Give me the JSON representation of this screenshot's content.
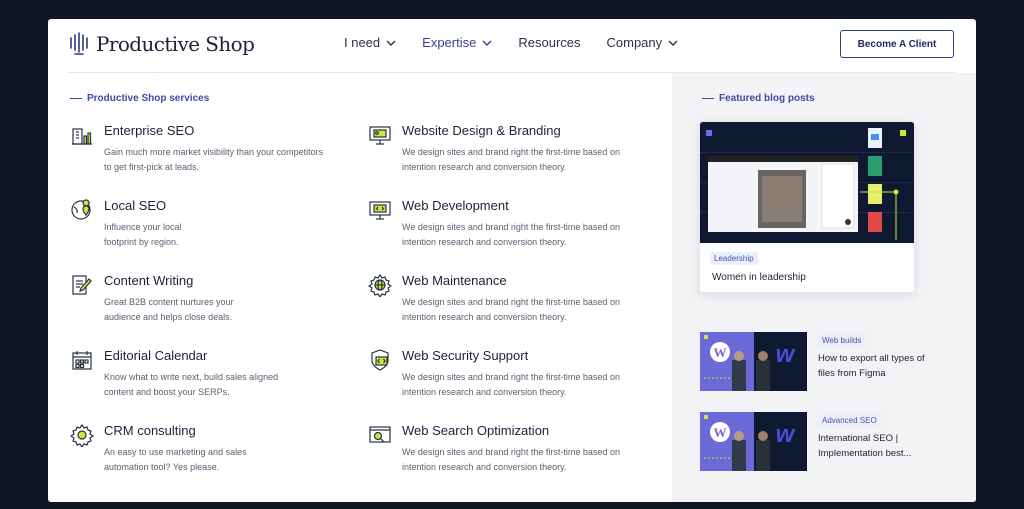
{
  "brand": {
    "name": "Productive Shop"
  },
  "nav": {
    "items": [
      {
        "label": "I need",
        "has_menu": true,
        "active": false
      },
      {
        "label": "Expertise",
        "has_menu": true,
        "active": true
      },
      {
        "label": "Resources",
        "has_menu": false,
        "active": false
      },
      {
        "label": "Company",
        "has_menu": true,
        "active": false
      }
    ],
    "cta_label": "Become A Client"
  },
  "colors": {
    "accent": "#3e4aa0",
    "highlight": "#d6f24a",
    "background": "#0e1626",
    "panel": "#f3f3f6"
  },
  "services": {
    "heading": "Productive Shop services",
    "items": [
      {
        "icon": "building-chart-icon",
        "title": "Enterprise SEO",
        "description": "Gain much more market visibility than your competitors to get first-pick at leads."
      },
      {
        "icon": "monitor-image-icon",
        "title": "Website Design & Branding",
        "description": "We design sites and brand right the first-time based on intention research and conversion theory."
      },
      {
        "icon": "globe-pin-icon",
        "title": "Local SEO",
        "description": "Influence your local footprint by region."
      },
      {
        "icon": "code-monitor-icon",
        "title": "Web Development",
        "description": "We design sites and brand right the first-time based on intention research and conversion theory."
      },
      {
        "icon": "document-pen-icon",
        "title": "Content Writing",
        "description": "Great B2B content nurtures your audience and helps close deals."
      },
      {
        "icon": "gear-globe-icon",
        "title": "Web Maintenance",
        "description": "We design sites and brand right the first-time based on intention research and conversion theory."
      },
      {
        "icon": "calendar-icon",
        "title": "Editorial Calendar",
        "description": "Know what to write next, build sales aligned content and boost your SERPs."
      },
      {
        "icon": "shield-code-icon",
        "title": "Web Security Support",
        "description": "We design sites and brand right the first-time based on intention research and conversion theory."
      },
      {
        "icon": "gear-icon",
        "title": "CRM consulting",
        "description": "An easy to use marketing and sales automation tool? Yes please."
      },
      {
        "icon": "search-monitor-icon",
        "title": "Web Search Optimization",
        "description": "We design sites and brand right the first-time based on intention research and conversion theory."
      }
    ]
  },
  "blog": {
    "heading": "Featured blog posts",
    "featured": {
      "tag": "Leadership",
      "title": "Women in leadership"
    },
    "posts": [
      {
        "tag": "Web builds",
        "title": "How to export all types of files from Figma"
      },
      {
        "tag": "Advanced SEO",
        "title": "International SEO | Implementation best..."
      }
    ]
  }
}
